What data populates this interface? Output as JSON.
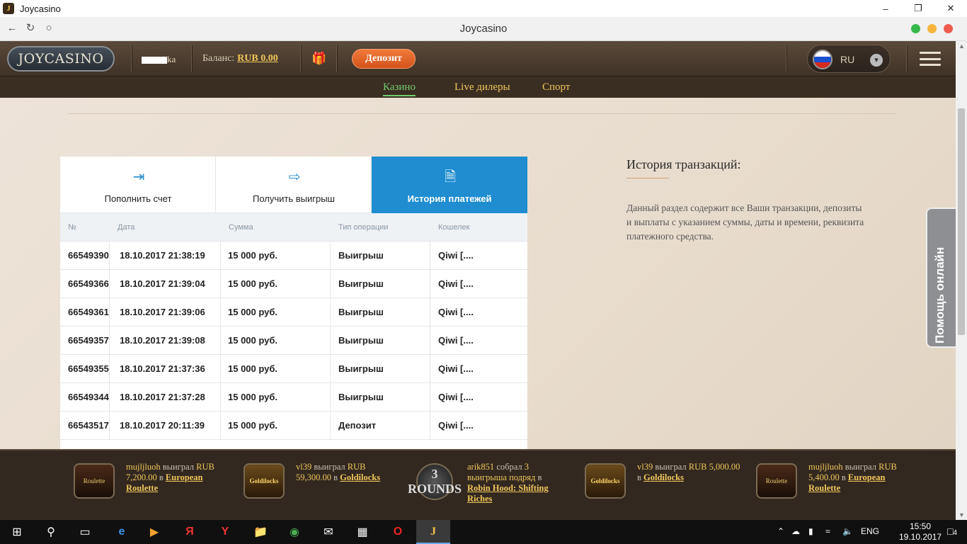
{
  "window": {
    "title": "Joycasino",
    "icon": "J"
  },
  "browser": {
    "page_title": "Joycasino"
  },
  "header": {
    "logo": "JOYCASINO",
    "username_visible": "ka",
    "balance_label": "Баланс:",
    "balance_value": "RUB 0.00",
    "deposit_label": "Депозит",
    "lang": "RU"
  },
  "subnav": {
    "items": [
      {
        "label": "Казино",
        "active": true
      },
      {
        "label": "Live дилеры",
        "active": false
      },
      {
        "label": "Спорт",
        "active": false
      }
    ]
  },
  "tabs": [
    {
      "label": "Пополнить счет",
      "icon": "deposit-icon"
    },
    {
      "label": "Получить выигрыш",
      "icon": "withdraw-icon"
    },
    {
      "label": "История платежей",
      "icon": "document-icon"
    }
  ],
  "table": {
    "headers": [
      "№",
      "Дата",
      "Сумма",
      "Тип операции",
      "Кошелек"
    ],
    "rows": [
      [
        "66549390",
        "18.10.2017 21:38:19",
        "15 000 руб.",
        "Выигрыш",
        "Qiwi [...."
      ],
      [
        "66549366",
        "18.10.2017 21:39:04",
        "15 000 руб.",
        "Выигрыш",
        "Qiwi [...."
      ],
      [
        "66549361",
        "18.10.2017 21:39:06",
        "15 000 руб.",
        "Выигрыш",
        "Qiwi [...."
      ],
      [
        "66549357",
        "18.10.2017 21:39:08",
        "15 000 руб.",
        "Выигрыш",
        "Qiwi [...."
      ],
      [
        "66549355",
        "18.10.2017 21:37:36",
        "15 000 руб.",
        "Выигрыш",
        "Qiwi [...."
      ],
      [
        "66549344",
        "18.10.2017 21:37:28",
        "15 000 руб.",
        "Выигрыш",
        "Qiwi [...."
      ],
      [
        "66543517",
        "18.10.2017 20:11:39",
        "15 000 руб.",
        "Депозит",
        "Qiwi [...."
      ]
    ]
  },
  "side": {
    "title": "История транзакций:",
    "text": "Данный раздел содержит все Ваши транзакции, депозиты и выплаты с указанием суммы, даты и времени, реквизита платежного средства."
  },
  "help": {
    "label": "Помощь онлайн"
  },
  "winners": [
    {
      "user": "mujljluoh",
      "verb": "выиграл",
      "amount": "RUB 7,200.00",
      "in": "в",
      "game": "European Roulette",
      "thumb": "Roulette"
    },
    {
      "user": "vl39",
      "verb": "выиграл",
      "amount": "RUB 59,300.00",
      "in": "в",
      "game": "Goldilocks",
      "thumb": "Goldilocks"
    },
    {
      "user": "arik851",
      "verb": "собрал",
      "amount": "3 выигрыша подряд",
      "in": "в",
      "game": "Robin Hood: Shifting Riches",
      "thumb": "3 ROUNDS"
    },
    {
      "user": "vl39",
      "verb": "выиграл",
      "amount": "RUB 5,000.00",
      "in": "в",
      "game": "Goldilocks",
      "thumb": "Goldilocks"
    },
    {
      "user": "mujljluoh",
      "verb": "выиграл",
      "amount": "RUB 5,400.00",
      "in": "в",
      "game": "European Roulette",
      "thumb": "Roulette"
    }
  ],
  "taskbar": {
    "lang": "ENG",
    "time": "15:50",
    "date": "19.10.2017",
    "notifications": "4"
  },
  "colors": {
    "accent_blue": "#1f8dd0",
    "deposit_orange": "#e2652a",
    "gold": "#f0c65a",
    "nav_active_green": "#6fcf6f"
  }
}
